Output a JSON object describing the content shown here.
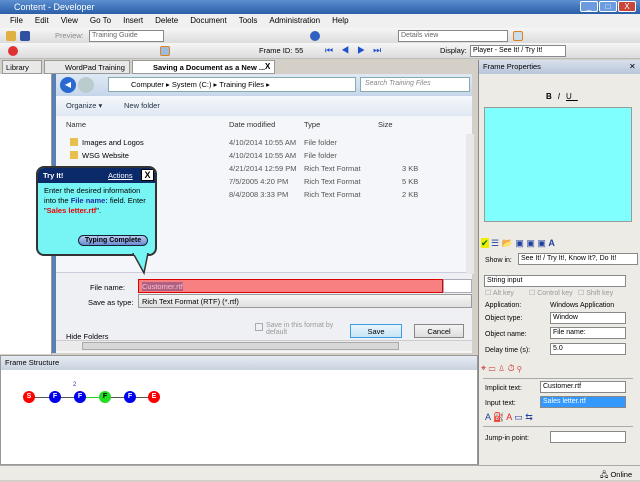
{
  "window": {
    "title": "Content - Developer",
    "min": "_",
    "max": "□",
    "close": "X"
  },
  "menu": [
    "File",
    "Edit",
    "View",
    "Go To",
    "Insert",
    "Delete",
    "Document",
    "Tools",
    "Administration",
    "Help"
  ],
  "toolbar1": {
    "preview_label": "Preview:",
    "preview_value": "Training Guide",
    "view_value": "Details view"
  },
  "toolbar2": {
    "frame_id_label": "Frame ID:",
    "frame_id": "55",
    "display_label": "Display:",
    "display_value": "Player - See It! / Try It!"
  },
  "tabs": [
    {
      "label": "Library"
    },
    {
      "label": "WordPad Training"
    },
    {
      "label": "Saving a Document as a New ...",
      "close": "X"
    }
  ],
  "dialog": {
    "breadcrumb": [
      "Computer",
      "System (C:)",
      "Training Files"
    ],
    "search_placeholder": "Search Training Files",
    "organize": "Organize ▾",
    "new_folder": "New folder",
    "columns": [
      "Name",
      "Date modified",
      "Type",
      "Size"
    ],
    "files": [
      {
        "name": "Images and Logos",
        "date": "4/10/2014 10:55 AM",
        "type": "File folder",
        "size": ""
      },
      {
        "name": "WSG Website",
        "date": "4/10/2014 10:55 AM",
        "type": "File folder",
        "size": ""
      },
      {
        "name": "",
        "date": "4/21/2014 12:59 PM",
        "type": "Rich Text Format",
        "size": "3 KB"
      },
      {
        "name": "",
        "date": "7/5/2005 4:20 PM",
        "type": "Rich Text Format",
        "size": "5 KB"
      },
      {
        "name": "",
        "date": "8/4/2008 3:33 PM",
        "type": "Rich Text Format",
        "size": "2 KB"
      }
    ],
    "file_name_label": "File name:",
    "file_name_value": "Customer.rtf",
    "save_type_label": "Save as type:",
    "save_type_value": "Rich Text Format (RTF) (*.rtf)",
    "save_default": "Save in this format by default",
    "hide_folders": "Hide Folders",
    "save": "Save",
    "cancel": "Cancel"
  },
  "callout": {
    "title": "Try It!",
    "actions": "Actions",
    "close": "X",
    "text1": "Enter the desired information into the ",
    "field": "File name:",
    "text2": " field. Enter \"",
    "value": "Sales letter.rtf",
    "text3": "\".",
    "button": "Typing Complete"
  },
  "frame_structure": {
    "title": "Frame Structure",
    "badge": "2",
    "nodes": [
      {
        "l": "S",
        "c": "#ff0000"
      },
      {
        "l": "F",
        "c": "#0000ee"
      },
      {
        "l": "F",
        "c": "#0000ee"
      },
      {
        "l": "F",
        "c": "#22dd22"
      },
      {
        "l": "F",
        "c": "#0000ee"
      },
      {
        "l": "E",
        "c": "#ff0000"
      }
    ]
  },
  "frame_properties": {
    "title": "Frame Properties",
    "show_in_label": "Show in:",
    "show_in_value": "See It! / Try It!, Know It?, Do It!",
    "action_type": "String input",
    "alt": "Alt key",
    "ctrl": "Control key",
    "shift": "Shift key",
    "application_label": "Application:",
    "application_value": "Windows Application",
    "object_type_label": "Object type:",
    "object_type_value": "Window",
    "object_name_label": "Object name:",
    "object_name_value": "File name:",
    "delay_label": "Delay time (s):",
    "delay_value": "5.0",
    "implicit_label": "Implicit text:",
    "implicit_value": "Customer.rtf",
    "input_label": "Input text:",
    "input_value": "Sales letter.rtf",
    "jump_label": "Jump-in point:",
    "jump_value": ""
  },
  "status": {
    "online": "Online"
  },
  "colors": {
    "cyan": "#80ffff",
    "field_highlight": "#f88080"
  }
}
